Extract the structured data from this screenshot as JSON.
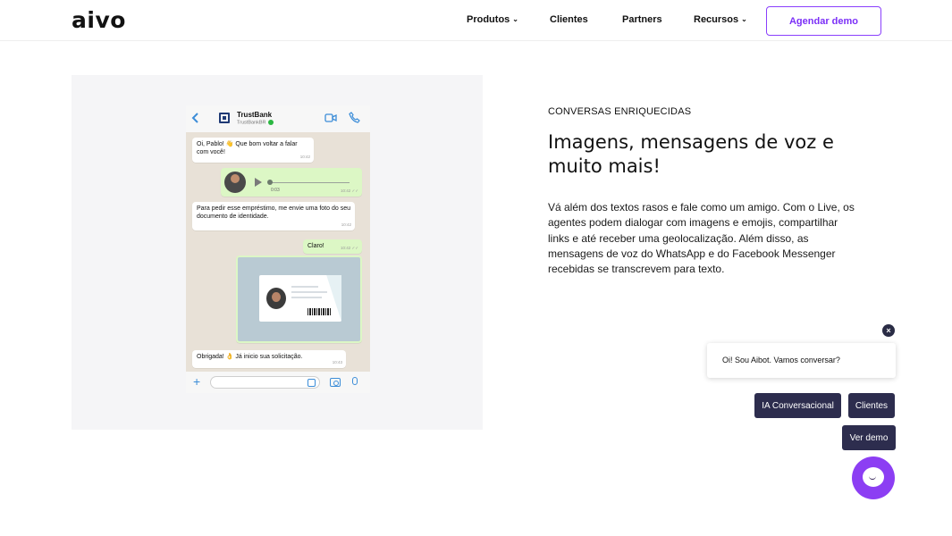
{
  "header": {
    "logo": "aivo",
    "nav": [
      {
        "label": "Produtos",
        "dropdown": true
      },
      {
        "label": "Clientes",
        "dropdown": false
      },
      {
        "label": "Partners",
        "dropdown": false
      },
      {
        "label": "Recursos",
        "dropdown": true
      }
    ],
    "cta_label": "Agendar demo",
    "chevron_glyph": "⌄"
  },
  "phone": {
    "contact_name": "TrustBank",
    "contact_handle": "TrustBankBR",
    "messages": [
      {
        "direction": "in",
        "text": "Oi, Pablo! 👋 Que bom voltar a falar com você!",
        "time": "10:42"
      },
      {
        "direction": "out",
        "type": "voice",
        "duration": "0:03",
        "time": "10:42 ✓✓"
      },
      {
        "direction": "in",
        "text": "Para pedir esse empréstimo, me envie uma foto do seu documento de identidade.",
        "time": "10:42"
      },
      {
        "direction": "out",
        "text": "Claro!",
        "time": "10:42 ✓✓"
      },
      {
        "direction": "out",
        "type": "image",
        "image": "id-document-photo"
      },
      {
        "direction": "in",
        "text": "Obrigada! 👌 Já inicio sua solicitação.",
        "time": "10:43"
      }
    ]
  },
  "content": {
    "eyebrow": "CONVERSAS ENRIQUECIDAS",
    "headline": "Imagens, mensagens de voz e muito mais!",
    "body": "Vá além dos textos rasos e fale como um amigo. Com o Live, os agentes podem dialogar com imagens e emojis, compartilhar links e até receber uma geolocalização. Além disso, as mensagens de voz do WhatsApp e do Facebook Messenger recebidas se transcrevem para texto."
  },
  "chat_widget": {
    "close_glyph": "×",
    "greeting": "Oi! Sou Aibot. Vamos conversar?",
    "quick_replies": [
      "IA Conversacional",
      "Clientes",
      "Ver demo"
    ]
  },
  "colors": {
    "accent": "#8c3ef3",
    "chip_bg": "#2d2d4e",
    "panel_bg": "#f5f5f7",
    "whatsapp_out": "#dcf7c5"
  }
}
